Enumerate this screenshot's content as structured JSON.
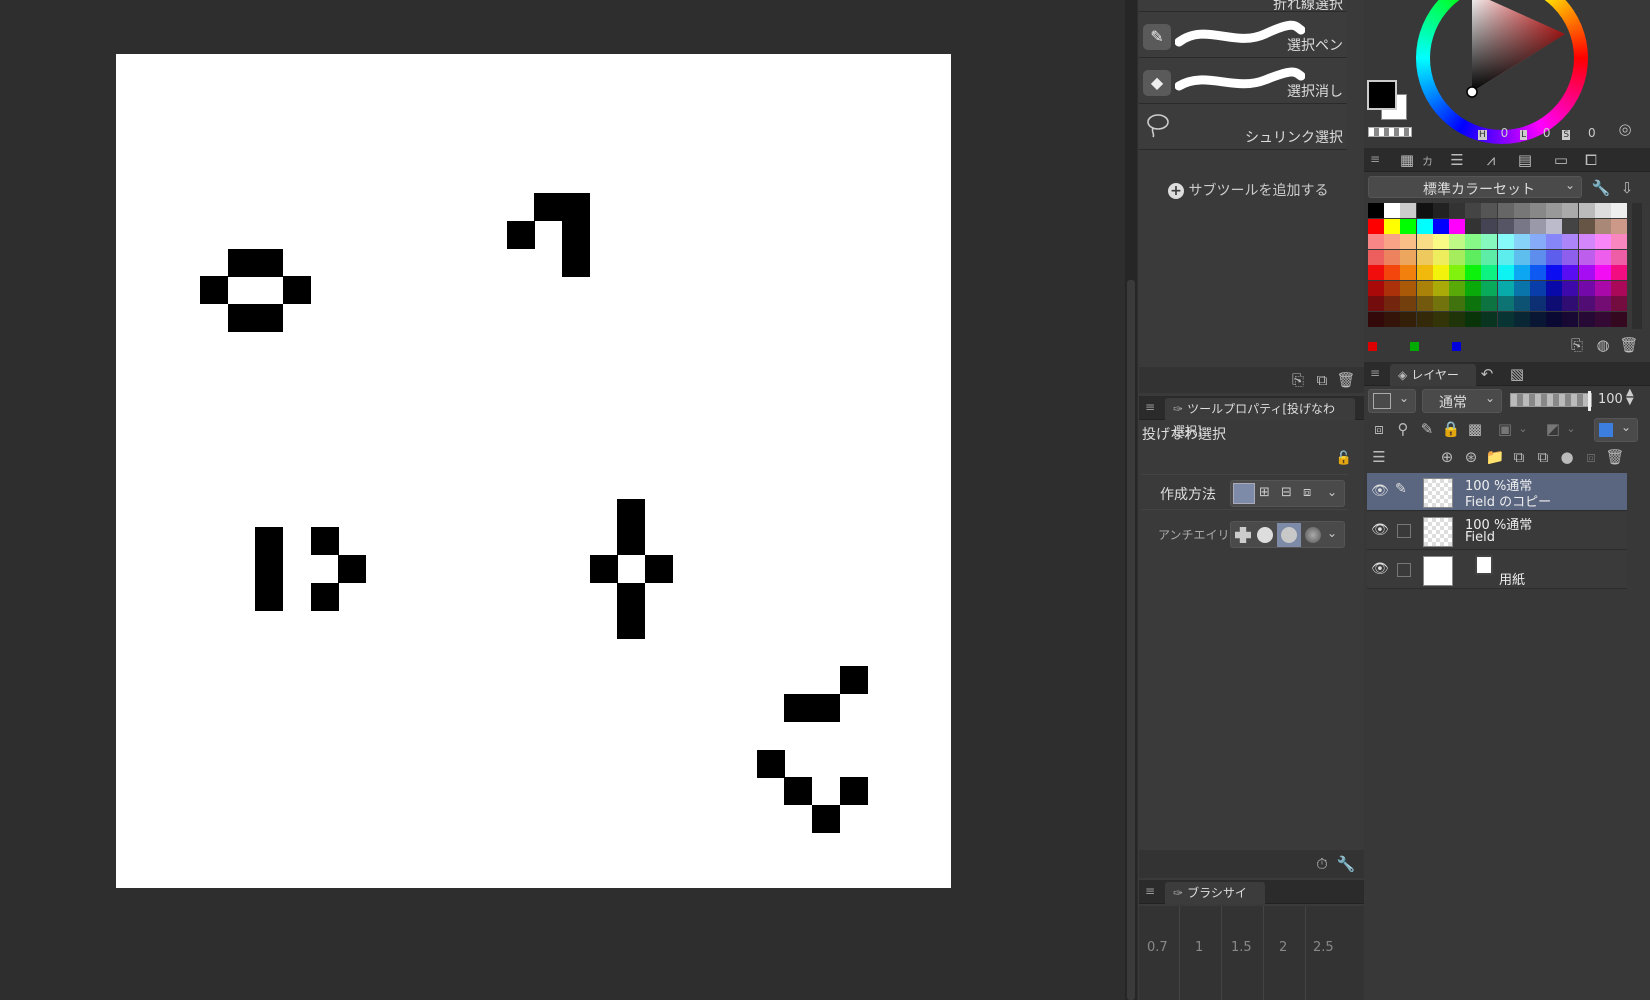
{
  "subtools": [
    {
      "label": "折れ線選択"
    },
    {
      "label": "選択ペン"
    },
    {
      "label": "選択消し"
    },
    {
      "label": "シュリンク選択"
    }
  ],
  "add_subtool_label": "サブツールを追加する",
  "tool_property": {
    "panel_title": "ツールプロパティ[投げなわ選択]",
    "tool_name": "投げなわ選択",
    "method_label": "作成方法",
    "antialias_label": "アンチエイリアス"
  },
  "brush_size": {
    "panel_title": "ブラシサイズ",
    "sizes": [
      "0.7",
      "1",
      "1.5",
      "2",
      "2.5"
    ]
  },
  "color_wheel": {
    "h_label": "H",
    "h_value": "0",
    "l_label": "L",
    "l_value": "0",
    "s_label": "S",
    "s_value": "0",
    "main_color": "#000000",
    "sub_color": "#ffffff"
  },
  "color_set": {
    "tab_label": "カ",
    "preset_name": "標準カラーセット"
  },
  "layers": {
    "tab_label": "レイヤー",
    "blend_mode": "通常",
    "opacity": "100",
    "items": [
      {
        "line1": "100 %通常",
        "line2": "Field のコピー",
        "selected": true
      },
      {
        "line1": "100 %通常",
        "line2": "Field",
        "selected": false
      },
      {
        "line1": "",
        "line2": "用紙",
        "selected": false
      }
    ]
  }
}
